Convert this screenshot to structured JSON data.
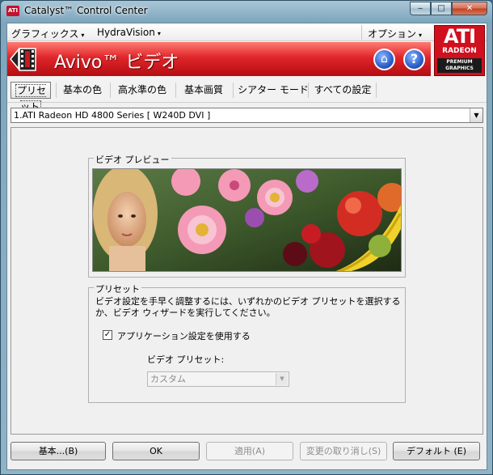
{
  "window": {
    "title": "Catalyst™ Control Center",
    "app_icon_text": "ATI",
    "min_symbol": "‒",
    "max_symbol": "□",
    "close_symbol": "✕"
  },
  "menu": {
    "graphics": "グラフィックス",
    "hydravision": "HydraVision",
    "options": "オプション",
    "arrow": "▾"
  },
  "banner": {
    "title": "Avivo™ ビデオ",
    "home_icon": "⌂",
    "help_icon": "?"
  },
  "logo": {
    "ati": "ATI",
    "radeon": "RADEON",
    "premium": "PREMIUM",
    "graphics": "GRAPHICS"
  },
  "tabs": [
    {
      "label": "プリセット",
      "active": true
    },
    {
      "label": "基本の色"
    },
    {
      "label": "高水準の色"
    },
    {
      "label": "基本画質"
    },
    {
      "label": "シアター モード"
    },
    {
      "label": "すべての設定"
    }
  ],
  "device_select": {
    "value": "1.ATI Radeon HD 4800 Series  [ W240D DVI ]",
    "arrow": "▼"
  },
  "preview": {
    "legend": "ビデオ プレビュー"
  },
  "preset": {
    "legend": "プリセット",
    "description": "ビデオ設定を手早く調整するには、いずれかのビデオ プリセットを選択するか、ビデオ ウィザードを実行してください。",
    "checkbox_label": "アプリケーション設定を使用する",
    "checkbox_checked": true,
    "checkbox_mark": "✓",
    "video_preset_label": "ビデオ プリセット:",
    "video_preset_value": "カスタム",
    "arrow": "▼"
  },
  "buttons": {
    "basic": "基本...(B)",
    "ok": "OK",
    "apply": "適用(A)",
    "discard": "変更の取り消し(S)",
    "default": "デフォルト (E)"
  },
  "colors": {
    "banner_red": "#e0262a",
    "ati_red": "#d0101e",
    "help_blue": "#2b5fc9"
  }
}
